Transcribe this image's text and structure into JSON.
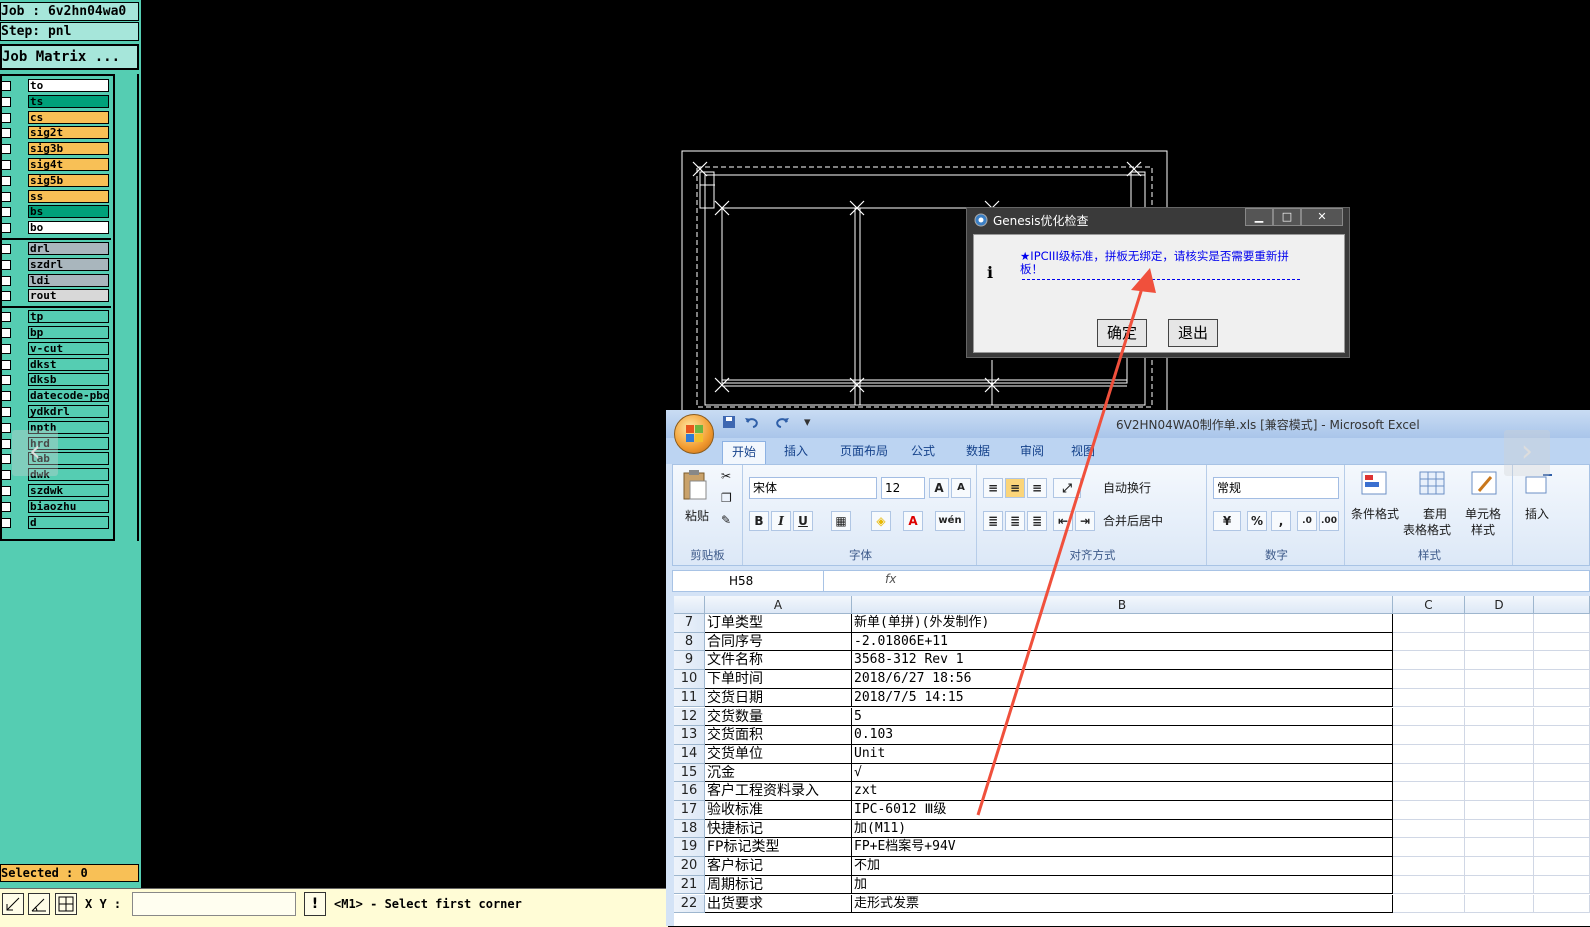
{
  "genesis": {
    "job_label": "Job : 6v2hn04wa0",
    "step_label": "Step: pnl",
    "job_matrix_button": "Job Matrix ...",
    "layers": [
      {
        "name": "to",
        "color": "#ffffff"
      },
      {
        "name": "ts",
        "color": "#00a07a"
      },
      {
        "name": "cs",
        "color": "#f8c056"
      },
      {
        "name": "sig2t",
        "color": "#f8c056"
      },
      {
        "name": "sig3b",
        "color": "#f8c056"
      },
      {
        "name": "sig4t",
        "color": "#f8c056"
      },
      {
        "name": "sig5b",
        "color": "#f8c056"
      },
      {
        "name": "ss",
        "color": "#f8c056"
      },
      {
        "name": "bs",
        "color": "#00a07a"
      },
      {
        "name": "bo",
        "color": "#ffffff"
      },
      {
        "name": "drl",
        "color": "#a9b6bd"
      },
      {
        "name": "szdrl",
        "color": "#a9b6bd"
      },
      {
        "name": "ldi",
        "color": "#a9b6bd"
      },
      {
        "name": "rout",
        "color": "#d8d8d8"
      },
      {
        "name": "tp",
        "color": "#55cdb2"
      },
      {
        "name": "bp",
        "color": "#55cdb2"
      },
      {
        "name": "v-cut",
        "color": "#55cdb2"
      },
      {
        "name": "dkst",
        "color": "#55cdb2"
      },
      {
        "name": "dksb",
        "color": "#55cdb2"
      },
      {
        "name": "datecode-pbo",
        "color": "#55cdb2"
      },
      {
        "name": "ydkdrl",
        "color": "#55cdb2"
      },
      {
        "name": "npth",
        "color": "#55cdb2"
      },
      {
        "name": "hrd",
        "color": "#55cdb2"
      },
      {
        "name": "lab",
        "color": "#55cdb2"
      },
      {
        "name": "dwk",
        "color": "#55cdb2"
      },
      {
        "name": "szdwk",
        "color": "#55cdb2"
      },
      {
        "name": "biaozhu",
        "color": "#55cdb2"
      },
      {
        "name": "d",
        "color": "#55cdb2"
      }
    ],
    "selected_label": "Selected : 0",
    "xy_label": "X Y :",
    "warn_symbol": "!",
    "status_message": "<M1> - Select first corner"
  },
  "nav": {
    "prev": "‹",
    "next": "›"
  },
  "dialog": {
    "title": "Genesis优化检查",
    "info_icon": "i",
    "message": "★IPCIII级标准，拼板无绑定，请核实是否需要重新拼板！",
    "ok_label": "确定",
    "exit_label": "退出",
    "min": "▁",
    "max": "□",
    "close": "✕"
  },
  "excel": {
    "title": "6V2HN04WA0制作单.xls  [兼容模式] - Microsoft Excel",
    "tabs": [
      "开始",
      "插入",
      "页面布局",
      "公式",
      "数据",
      "审阅",
      "视图"
    ],
    "ribbon": {
      "paste": "粘贴",
      "clipboard_group": "剪贴板",
      "font_name": "宋体",
      "font_size": "12",
      "font_group": "字体",
      "wrap_text": "自动换行",
      "merge_center": "合并后居中",
      "align_group": "对齐方式",
      "number_format": "常规",
      "number_group": "数字",
      "cond_format": "条件格式",
      "table_format_1": "套用",
      "table_format_2": "表格格式",
      "cell_style_1": "单元格",
      "cell_style_2": "样式",
      "styles_group": "样式",
      "insert": "插入",
      "bold": "B",
      "italic": "I",
      "underline": "U",
      "percent": "%",
      "comma": ","
    },
    "name_box": "H58",
    "fx_label": "fx",
    "columns": [
      "A",
      "B",
      "C",
      "D"
    ],
    "rows": [
      {
        "num": "7",
        "a": "订单类型",
        "b": "新单(单拼)(外发制作)"
      },
      {
        "num": "8",
        "a": "合同序号",
        "b": "-2.01806E+11"
      },
      {
        "num": "9",
        "a": "文件名称",
        "b": "3568-312 Rev 1"
      },
      {
        "num": "10",
        "a": "下单时间",
        "b": "2018/6/27 18:56"
      },
      {
        "num": "11",
        "a": "交货日期",
        "b": "2018/7/5 14:15"
      },
      {
        "num": "12",
        "a": "交货数量",
        "b": "5"
      },
      {
        "num": "13",
        "a": "交货面积",
        "b": "0.103"
      },
      {
        "num": "14",
        "a": "交货单位",
        "b": "Unit"
      },
      {
        "num": "15",
        "a": "沉金",
        "b": "√"
      },
      {
        "num": "16",
        "a": "客户工程资料录入",
        "b": "zxt"
      },
      {
        "num": "17",
        "a": "验收标准",
        "b": "IPC-6012 Ⅲ级"
      },
      {
        "num": "18",
        "a": "快捷标记",
        "b": "加(M11)"
      },
      {
        "num": "19",
        "a": "FP标记类型",
        "b": "FP+E档案号+94V"
      },
      {
        "num": "20",
        "a": "客户标记",
        "b": "不加"
      },
      {
        "num": "21",
        "a": "周期标记",
        "b": "加"
      },
      {
        "num": "22",
        "a": "出货要求",
        "b": "走形式发票"
      }
    ]
  },
  "colors": {
    "panel": "#55cdb2",
    "arrow": "#f0503c",
    "dialog_text": "#0000ee"
  }
}
